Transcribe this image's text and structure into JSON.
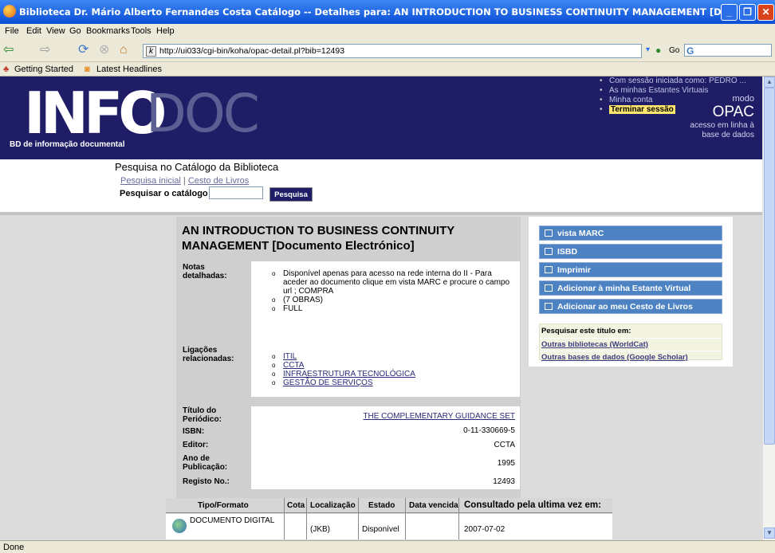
{
  "window": {
    "title": "Biblioteca Dr. Mário Alberto Fernandes Costa Catálogo -- Detalhes para: AN INTRODUCTION TO BUSINESS CONTINUITY MANAGEMENT [Documento Electrónico] - Mozilla Fi...",
    "min": "_",
    "max": "❐",
    "close": "✕"
  },
  "menu": [
    "File",
    "Edit",
    "View",
    "Go",
    "Bookmarks",
    "Tools",
    "Help"
  ],
  "nav": {
    "url": "http://ui033/cgi-bin/koha/opac-detail.pl?bib=12493",
    "go_label": "Go"
  },
  "bookmarks": [
    "Getting Started",
    "Latest Headlines"
  ],
  "banner": {
    "logo": "INFO",
    "logo2": "DOC",
    "subtitle": "BD de informação documental",
    "links": [
      "Com sessão iniciada como: PEDRO ...",
      "As minhas Estantes Virtuais",
      "Minha conta",
      "Terminar sessão"
    ],
    "modo": "modo",
    "opac": "OPAC",
    "acesso1": "acesso em linha à",
    "acesso2": "base de dados"
  },
  "search": {
    "heading": "Pesquisa no Catálogo da Biblioteca",
    "link1": "Pesquisa inicial",
    "sep": "|",
    "link2": "Cesto de Livros",
    "label": "Pesquisar o catálogo",
    "button": "Pesquisa"
  },
  "record": {
    "title": "AN INTRODUCTION TO BUSINESS CONTINUITY MANAGEMENT [Documento Electrónico]",
    "notas_label": "Notas detalhadas:",
    "notas": [
      "Disponível apenas para acesso na rede interna do II - Para aceder ao documento clique em vista MARC e procure o campo url ; COMPRA",
      "(7 OBRAS)",
      "FULL"
    ],
    "ligacoes_label": "Ligações relacionadas:",
    "ligacoes": [
      "ITIL",
      "CCTA",
      "INFRAESTRUTURA TECNOLÓGICA",
      "GESTÃO DE SERVIÇOS"
    ],
    "periodico_label": "Título do Periódico:",
    "periodico": "THE COMPLEMENTARY GUIDANCE SET",
    "isbn_label": "ISBN:",
    "isbn": "0-11-330669-5",
    "editor_label": "Editor:",
    "editor": "CCTA",
    "ano_label": "Ano de Publicação:",
    "ano": "1995",
    "registo_label": "Registo No.:",
    "registo": "12493"
  },
  "side": {
    "buttons": [
      "vista MARC",
      "ISBD",
      "Imprimir",
      "Adicionar à minha Estante Virtual",
      "Adicionar ao meu Cesto de Livros"
    ],
    "search_heading": "Pesquisar este título em:",
    "search_links": [
      "Outras bibliotecas (WorldCat)",
      "Outras bases de dados (Google Scholar)"
    ]
  },
  "holdings": {
    "headers": [
      "Tipo/Formato",
      "Cota",
      "Localização",
      "Estado",
      "Data vencida",
      "Consultado pela ultima vez em:"
    ],
    "row": {
      "tipo": "DOCUMENTO DIGITAL",
      "cota": "",
      "localizacao": "(JKB)",
      "estado": "Disponível",
      "data_vencida": "",
      "consultado": "2007-07-02"
    }
  },
  "status": "Done"
}
